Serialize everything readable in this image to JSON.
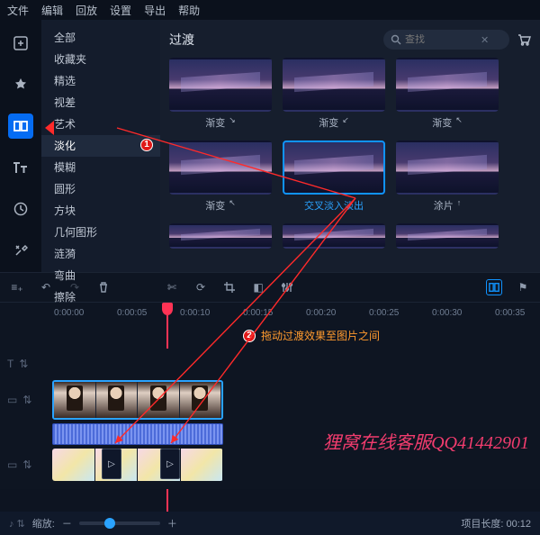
{
  "menu": [
    "文件",
    "编辑",
    "回放",
    "设置",
    "导出",
    "帮助"
  ],
  "left_tools": [
    {
      "name": "add-media-icon",
      "active": false
    },
    {
      "name": "pin-icon",
      "active": false
    },
    {
      "name": "transitions-icon",
      "active": true
    },
    {
      "name": "titles-icon",
      "active": false
    },
    {
      "name": "clock-icon",
      "active": false
    },
    {
      "name": "tools-icon",
      "active": false
    }
  ],
  "categories": [
    "全部",
    "收藏夹",
    "精选",
    "视差",
    "艺术"
  ],
  "selected_category": "淡化",
  "selected_badge": "1",
  "categories_after": [
    "模糊",
    "圆形",
    "方块",
    "几何图形",
    "涟漪",
    "弯曲",
    "擦除"
  ],
  "panel_title": "过渡",
  "search": {
    "placeholder": "查找"
  },
  "thumbs_row1": [
    {
      "label": "渐变",
      "arrow": "↘"
    },
    {
      "label": "渐变",
      "arrow": "↙"
    },
    {
      "label": "渐变",
      "arrow": "↖"
    }
  ],
  "thumbs_row2": [
    {
      "label": "渐变",
      "arrow": "↖",
      "sel": false
    },
    {
      "label": "交叉淡入淡出",
      "arrow": "",
      "sel": true
    },
    {
      "label": "涂片",
      "arrow": "↑",
      "sel": false
    }
  ],
  "toolbar_icons": [
    "undo",
    "redo",
    "delete",
    "cut",
    "rotate",
    "crop",
    "adjust",
    "levels",
    "marker-active",
    "flag"
  ],
  "ruler_ticks": [
    "0:00:00",
    "0:00:05",
    "0:00:10",
    "0:00:15",
    "0:00:20",
    "0:00:25",
    "0:00:30",
    "0:00:35"
  ],
  "hint": {
    "badge": "2",
    "text": "拖动过渡效果至图片之间"
  },
  "watermark": "狸窝在线客服QQ41442901",
  "zoom_label": "缩放:",
  "duration_label": "项目长度:",
  "duration_value": "00:12"
}
